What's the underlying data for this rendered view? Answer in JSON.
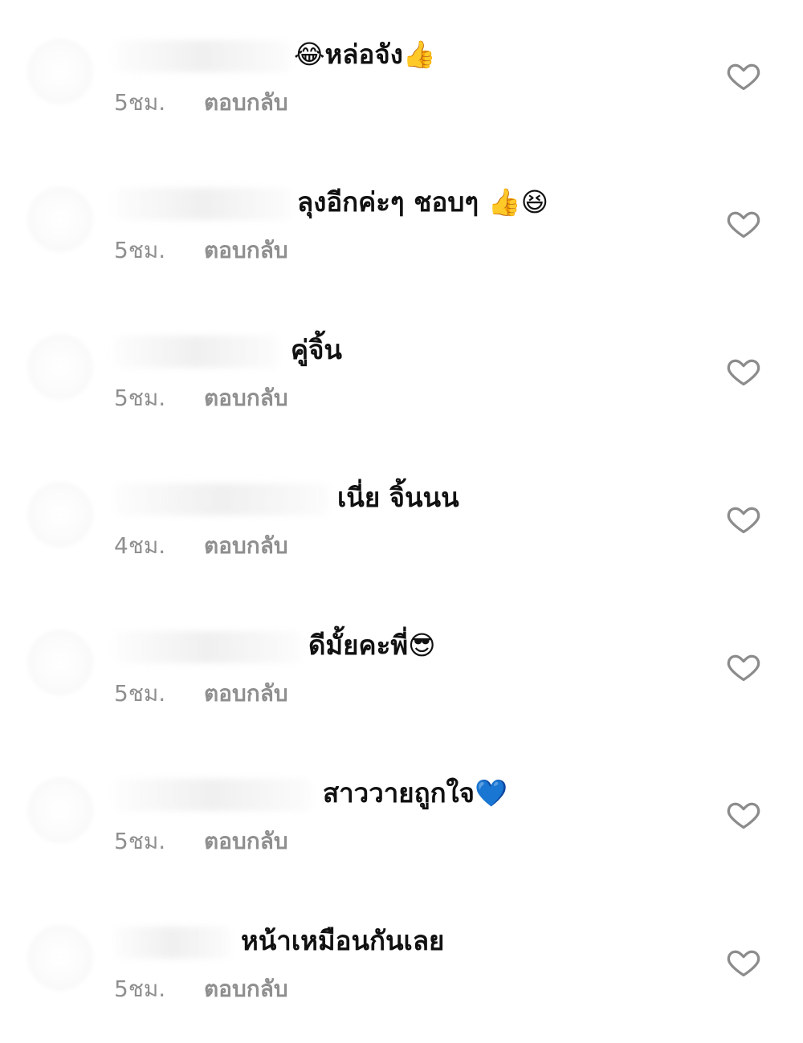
{
  "comments": [
    {
      "time": "5ชม.",
      "reply_label": "ตอบกลับ",
      "text": "😂หล่อจัง👍"
    },
    {
      "time": "5ชม.",
      "reply_label": "ตอบกลับ",
      "text": "ลุงอีกค่ะๆ ชอบๆ 👍😆"
    },
    {
      "time": "5ชม.",
      "reply_label": "ตอบกลับ",
      "text": "คู่จิ้น"
    },
    {
      "time": "4ชม.",
      "reply_label": "ตอบกลับ",
      "text": "เนี่ย จิ้นนน"
    },
    {
      "time": "5ชม.",
      "reply_label": "ตอบกลับ",
      "text": "ดีมั้ยคะพี่😎"
    },
    {
      "time": "5ชม.",
      "reply_label": "ตอบกลับ",
      "text": "สาววายถูกใจ💙"
    },
    {
      "time": "5ชม.",
      "reply_label": "ตอบกลับ",
      "text": "หน้าเหมือนกันเลย"
    }
  ],
  "icons": {
    "like": "heart-icon"
  }
}
